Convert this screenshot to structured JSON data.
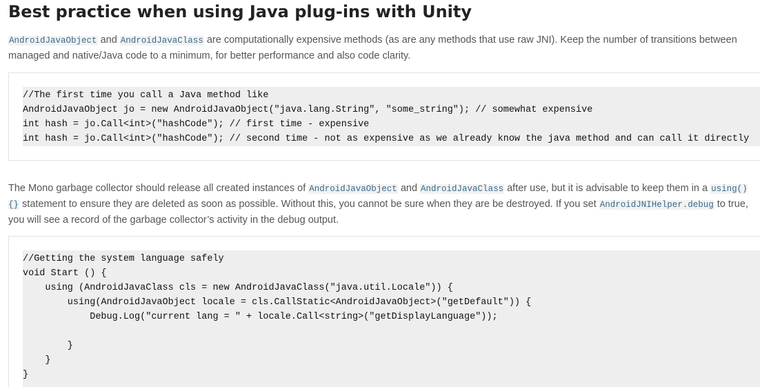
{
  "heading": "Best practice when using Java plug-ins with Unity",
  "para1": {
    "code1": "AndroidJavaObject",
    "t1": " and ",
    "code2": "AndroidJavaClass",
    "t2": " are computationally expensive methods (as are any methods that use raw JNI). Keep the number of transitions between managed and native/Java code to a minimum, for better performance and also code clarity."
  },
  "code_block_1": [
    "//The first time you call a Java method like",
    "AndroidJavaObject jo = new AndroidJavaObject(\"java.lang.String\", \"some_string\"); // somewhat expensive",
    "int hash = jo.Call<int>(\"hashCode\"); // first time - expensive",
    "int hash = jo.Call<int>(\"hashCode\"); // second time - not as expensive as we already know the java method and can call it directly"
  ],
  "para2": {
    "t1": "The Mono garbage collector should release all created instances of ",
    "code1": "AndroidJavaObject",
    "t2": " and ",
    "code2": "AndroidJavaClass",
    "t3": " after use, but it is advisable to keep them in a ",
    "code3": "using(){}",
    "t4": " statement to ensure they are deleted as soon as possible. Without this, you cannot be sure when they are be destroyed. If you set ",
    "code4": "AndroidJNIHelper.debug",
    "t5": " to true, you will see a record of the garbage collector’s activity in the debug output."
  },
  "code_block_2": [
    "//Getting the system language safely",
    "void Start () {",
    "    using (AndroidJavaClass cls = new AndroidJavaClass(\"java.util.Locale\")) {",
    "        using(AndroidJavaObject locale = cls.CallStatic<AndroidJavaObject>(\"getDefault\")) {",
    "            Debug.Log(\"current lang = \" + locale.Call<string>(\"getDisplayLanguage\"));",
    "",
    "        }",
    "    }",
    "}"
  ]
}
